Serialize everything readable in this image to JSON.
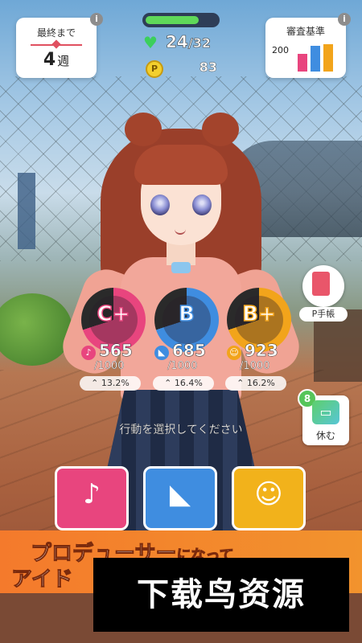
{
  "hud": {
    "weeks_label": "最終まで",
    "weeks_value": "4",
    "weeks_unit": "週",
    "info_glyph": "i",
    "hp_current": "24",
    "hp_max": "/32",
    "hp_fill_fraction": 0.75,
    "coin_glyph": "P",
    "coin_value": "83",
    "criteria_title": "審査基準",
    "criteria_num": "200",
    "criteria_bars": [
      {
        "value": 0.55,
        "color": "#e8457e"
      },
      {
        "value": 0.8,
        "color": "#3f8de0"
      },
      {
        "value": 0.85,
        "color": "#f2a41b"
      }
    ]
  },
  "stats": [
    {
      "grade": "C+",
      "icon": "microphone-icon",
      "value": "565",
      "max": "/1000",
      "rate": "13.2%",
      "color": "#e8457e"
    },
    {
      "grade": "B",
      "icon": "dance-shoe-icon",
      "value": "685",
      "max": "/1000",
      "rate": "16.4%",
      "color": "#3f8de0"
    },
    {
      "grade": "B+",
      "icon": "visual-face-icon",
      "value": "923",
      "max": "/1000",
      "rate": "16.2%",
      "color": "#f2a41b"
    }
  ],
  "side": {
    "pbook_label": "P手帳",
    "rest_label": "休む",
    "rest_badge": "8"
  },
  "prompt": "行動を選択してください",
  "actions": [
    {
      "name": "vocal",
      "icon": "microphone-icon",
      "color": "#e8457e"
    },
    {
      "name": "dance",
      "icon": "dance-shoe-icon",
      "color": "#3f8de0"
    },
    {
      "name": "visual",
      "icon": "visual-face-icon",
      "color": "#f2b21b"
    }
  ],
  "banner": {
    "line1": "プロデューサー",
    "line1_small": "になって",
    "line2": "アイド"
  },
  "watermark": "下载鸟资源"
}
